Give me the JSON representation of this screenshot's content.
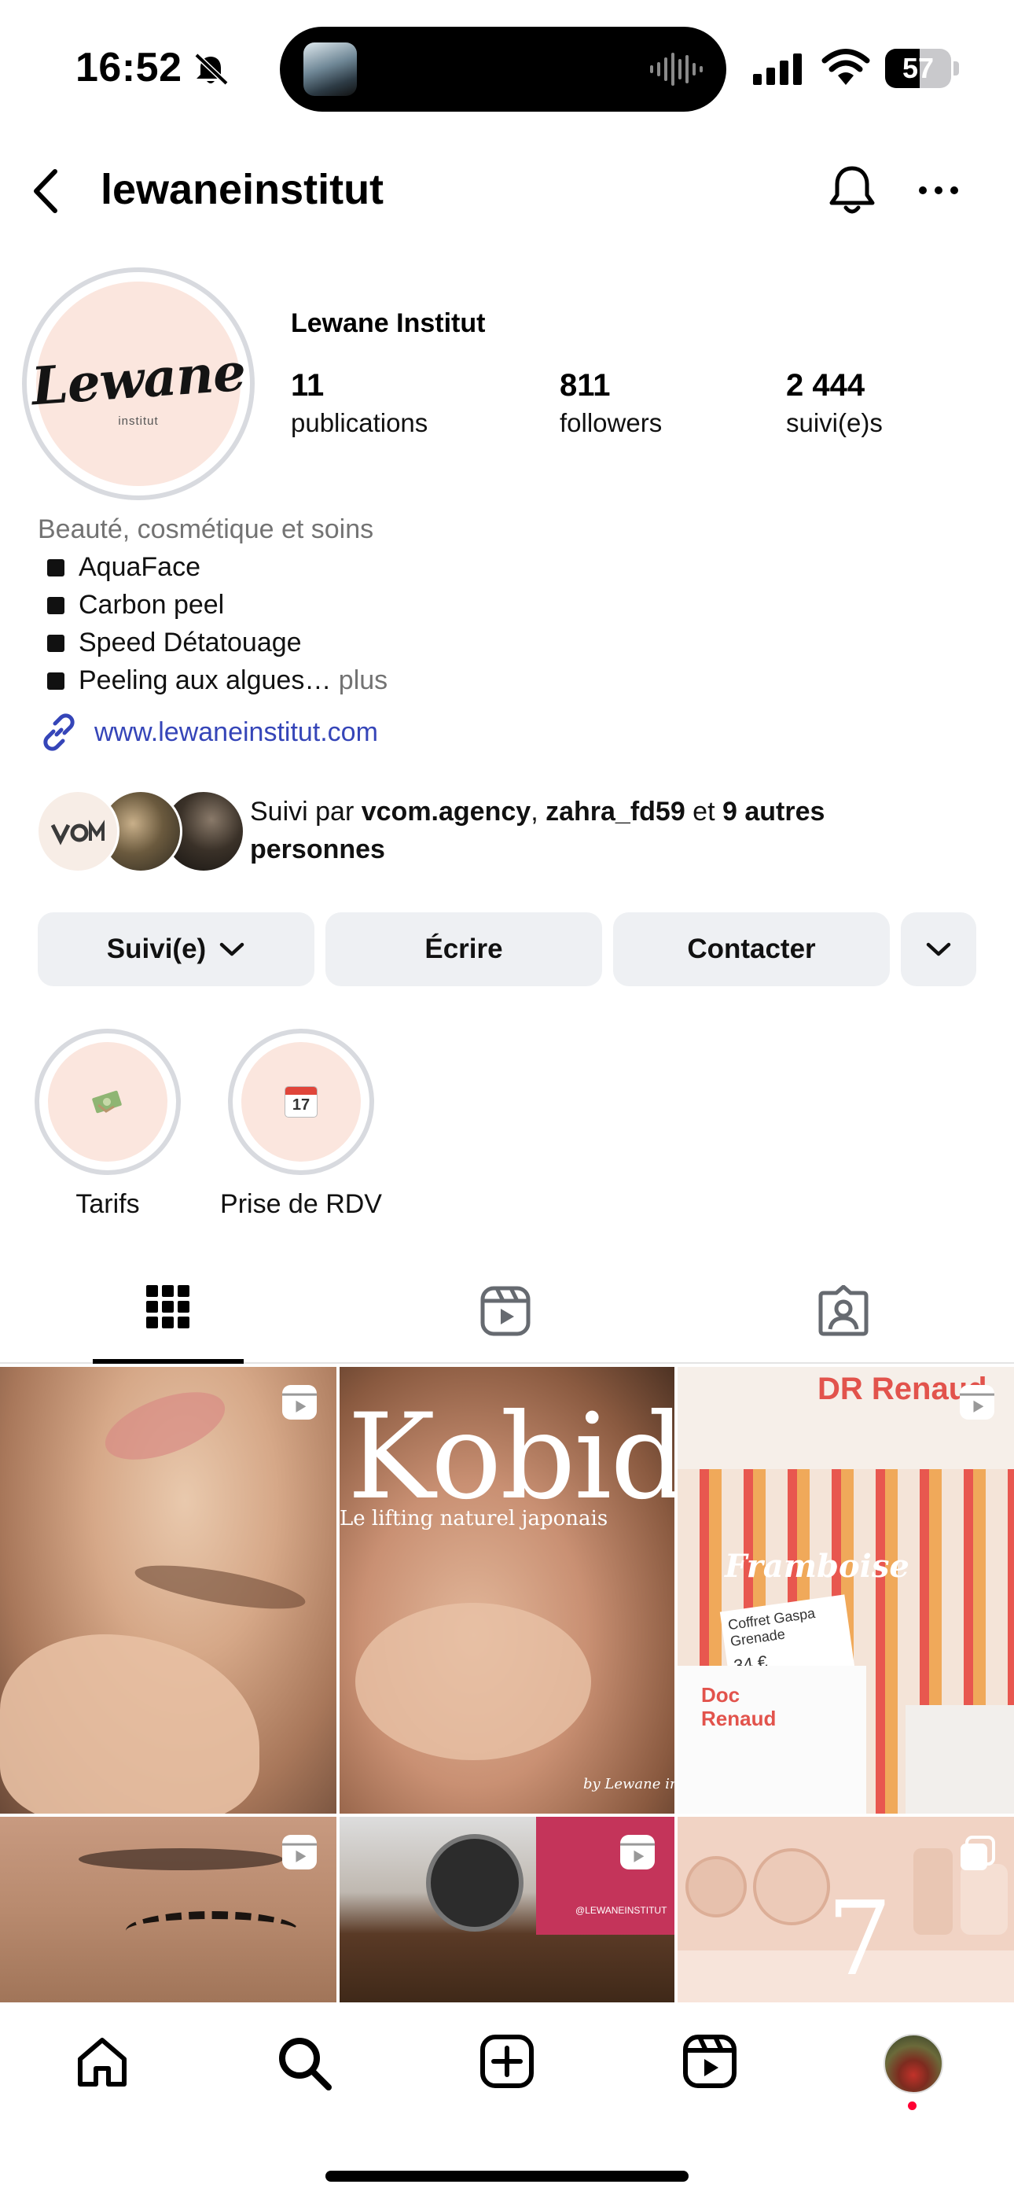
{
  "status_bar": {
    "time": "16:52",
    "battery": "57"
  },
  "header": {
    "username": "lewaneinstitut"
  },
  "profile": {
    "logo_text": "Lewane",
    "logo_subtext": "institut",
    "display_name": "Lewane Institut",
    "stats": [
      {
        "value": "11",
        "label": "publications"
      },
      {
        "value": "811",
        "label": "followers"
      },
      {
        "value": "2 444",
        "label": "suivi(e)s"
      }
    ],
    "category": "Beauté, cosmétique et soins",
    "bio_lines": [
      "AquaFace",
      "Carbon peel",
      "Speed Détatouage",
      "Peeling aux algues…"
    ],
    "bio_more": "plus",
    "website": "www.lewaneinstitut.com",
    "followed_by": {
      "prefix": "Suivi par ",
      "user1": "vcom.agency",
      "sep": ", ",
      "user2": "zahra_fd59",
      "and": " et ",
      "others": "9 autres personnes"
    }
  },
  "buttons": {
    "following": "Suivi(e)",
    "message": "Écrire",
    "contact": "Contacter"
  },
  "highlights": [
    {
      "label": "Tarifs",
      "icon": "money-icon"
    },
    {
      "label": "Prise de RDV",
      "icon": "calendar-icon",
      "icon_text": "17"
    }
  ],
  "tabs": [
    "grid-icon",
    "reels-icon",
    "tagged-icon"
  ],
  "posts": [
    {
      "type": "reel",
      "subject": "face treatment close-up"
    },
    {
      "type": "reel",
      "title": "Kobido",
      "subtitle": "Le lifting naturel japonais",
      "signature": "by Lewane ins"
    },
    {
      "type": "reel",
      "brand": "DR Renaud",
      "product": "Framboise",
      "tag_text": "Coffret Gaspa Grenade",
      "price": "34 €",
      "brand2_line1": "Doc",
      "brand2_line2": "Renaud"
    },
    {
      "type": "reel",
      "subject": "lash close-up"
    },
    {
      "type": "reel",
      "watermark": "@LEWANEINSTITUT"
    },
    {
      "type": "carousel",
      "number": "7"
    }
  ],
  "colors": {
    "link": "#3545b8",
    "button_bg": "#eef0f3",
    "accent_pink": "#fbe6de",
    "notification_dot": "#ff0033"
  }
}
